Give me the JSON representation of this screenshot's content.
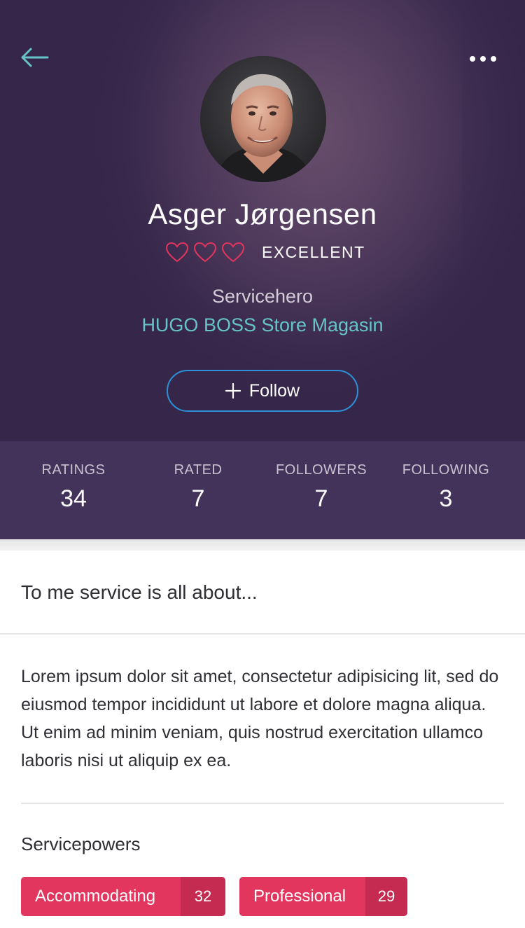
{
  "header": {
    "back_icon": "arrow-left-icon",
    "more_icon": "more-horizontal-icon",
    "back_color": "#66c4c9"
  },
  "profile": {
    "name": "Asger Jørgensen",
    "rating_hearts": 3,
    "rating_label": "EXCELLENT",
    "role": "Servicehero",
    "store": "HUGO BOSS Store Magasin",
    "follow_label": "Follow",
    "heart_color": "#e2365e",
    "link_color": "#66c4c9"
  },
  "stats": [
    {
      "label": "RATINGS",
      "value": "34"
    },
    {
      "label": "RATED",
      "value": "7"
    },
    {
      "label": "FOLLOWERS",
      "value": "7"
    },
    {
      "label": "FOLLOWING",
      "value": "3"
    }
  ],
  "about": {
    "title": "To me service is all about...",
    "text": "Lorem ipsum dolor sit amet, consectetur adipisicing lit, sed do eiusmod tempor incididunt ut labore et dolore magna aliqua. Ut enim ad minim veniam, quis nostrud exercitation ullamco laboris nisi ut aliquip ex ea."
  },
  "servicepowers": {
    "title": "Servicepowers",
    "tags": [
      {
        "label": "Accommodating",
        "count": "32"
      },
      {
        "label": "Professional",
        "count": "29"
      }
    ],
    "tag_color": "#e2365e"
  }
}
